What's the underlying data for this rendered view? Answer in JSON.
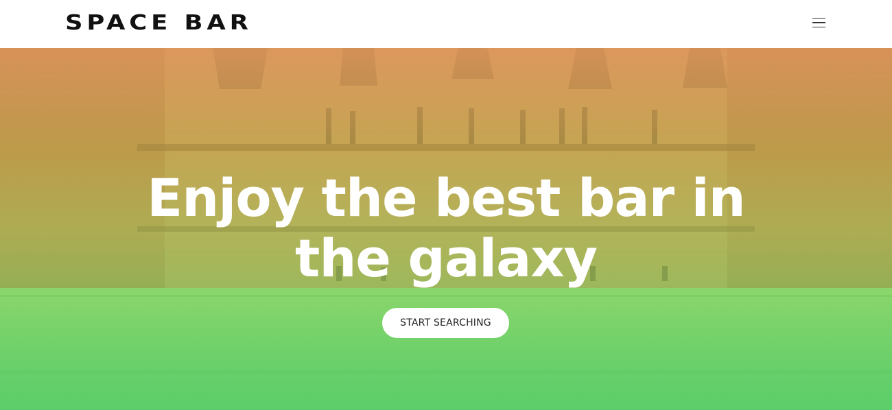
{
  "navbar": {
    "logo_text": "SPACE BAR",
    "menu_icon": "hamburger-menu-icon"
  },
  "hero": {
    "background_image": "bar-interior-photo",
    "headline": "Enjoy the best bar in the galaxy",
    "cta_label": "START SEARCHING"
  },
  "colors": {
    "gradient_top": "#e89b5f",
    "gradient_bottom": "#5fd26e",
    "button_bg": "#ffffff",
    "headline_text": "#ffffff"
  }
}
